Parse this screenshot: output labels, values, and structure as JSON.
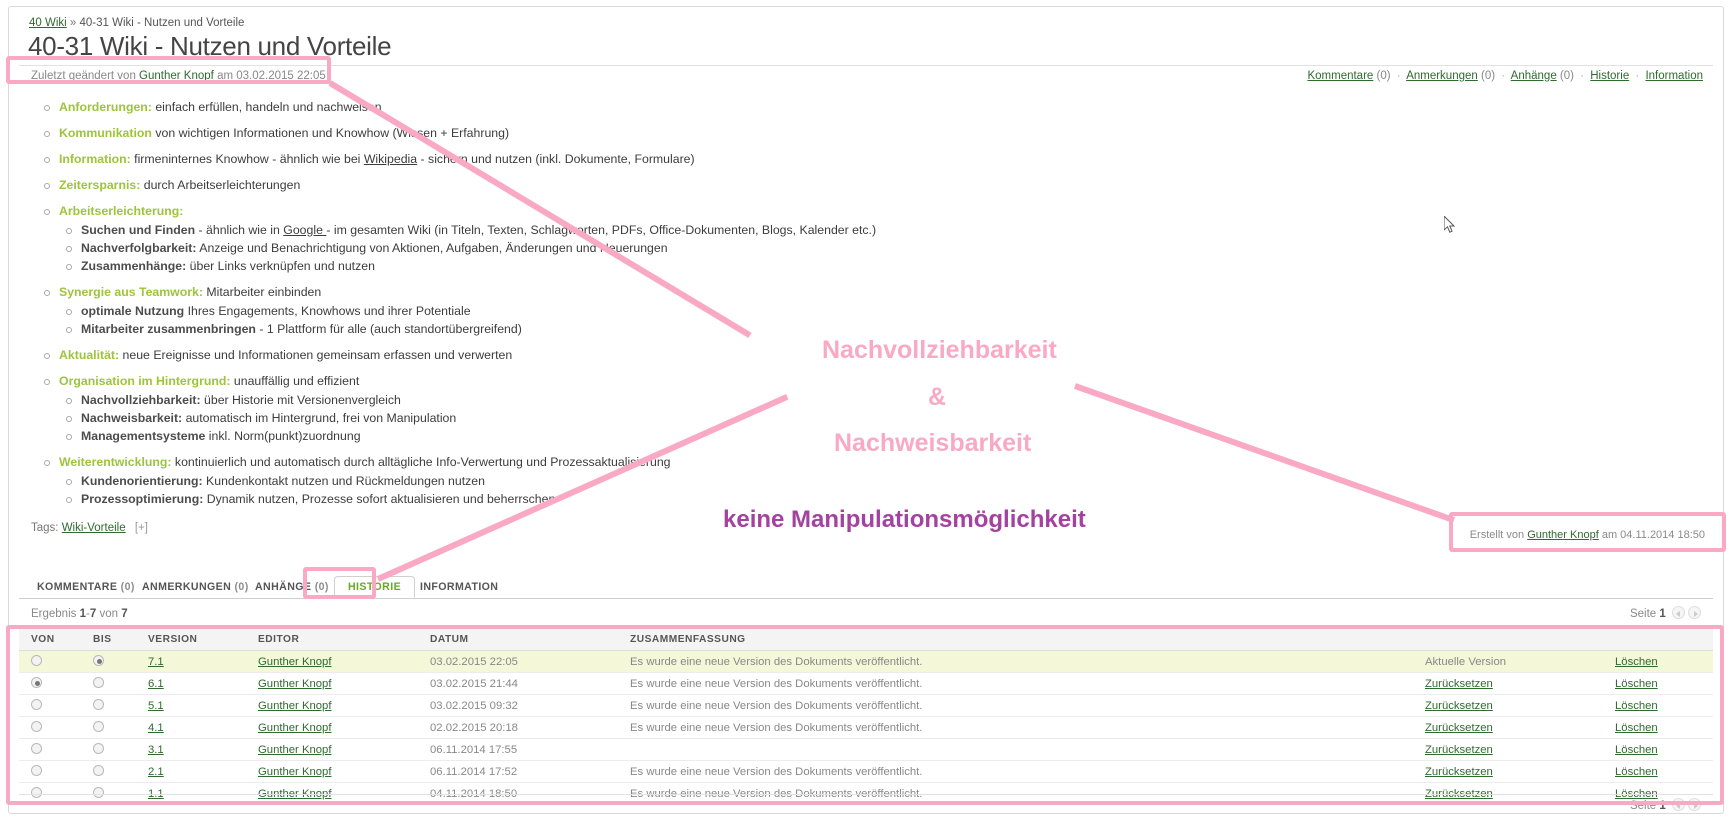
{
  "breadcrumb": {
    "root": "40 Wiki",
    "separator": "»",
    "current": "40-31 Wiki - Nutzen und Vorteile"
  },
  "page_title": "40-31 Wiki - Nutzen und Vorteile",
  "meta": {
    "modified_prefix": "Zuletzt geändert von",
    "modified_author": "Gunther Knopf",
    "modified_middle": "am",
    "modified_date": "03.02.2015 22:05"
  },
  "action_links": [
    {
      "label": "Kommentare",
      "count": "(0)"
    },
    {
      "label": "Anmerkungen",
      "count": "(0)"
    },
    {
      "label": "Anhänge",
      "count": "(0)"
    },
    {
      "label": "Historie",
      "count": ""
    },
    {
      "label": "Information",
      "count": ""
    }
  ],
  "content": {
    "items": [
      {
        "key": "Anforderungen:",
        "rest": " einfach erfüllen, handeln und nachweisen",
        "sub": []
      },
      {
        "key": "Kommunikation",
        "rest": " von wichtigen Informationen und Knowhow (Wissen + Erfahrung)",
        "sub": []
      },
      {
        "key": "Information:",
        "rest": " firmeninternes Knowhow - ähnlich wie bei ",
        "link": "Wikipedia",
        "rest2": " - sichern und nutzen (inkl. Dokumente, Formulare)",
        "sub": []
      },
      {
        "key": "Zeitersparnis:",
        "rest": " durch Arbeitserleichterungen",
        "sub": []
      },
      {
        "key": "Arbeitserleichterung:",
        "rest": "",
        "sub": [
          {
            "key": "Suchen und Finden",
            "rest": " - ähnlich wie in ",
            "link": "Google ",
            "rest2": "- im gesamten Wiki (in Titeln, Texten, Schlagworten, PDFs, Office-Dokumenten, Blogs, Kalender etc.)"
          },
          {
            "key": "Nachverfolgbarkeit:",
            "rest": " Anzeige und Benachrichtigung von Aktionen, Aufgaben, Änderungen und Neuerungen"
          },
          {
            "key": "Zusammenhänge:",
            "rest": " über Links verknüpfen und nutzen"
          }
        ]
      },
      {
        "key": "Synergie aus Teamwork:",
        "rest": " Mitarbeiter einbinden",
        "sub": [
          {
            "key": "optimale Nutzung",
            "rest": " Ihres Engagements, Knowhows und ihrer Potentiale"
          },
          {
            "key": "Mitarbeiter zusammenbringen",
            "rest": " - 1 Plattform für alle (auch standortübergreifend)"
          }
        ]
      },
      {
        "key": "Aktualität:",
        "rest": " neue Ereignisse und Informationen gemeinsam erfassen und verwerten",
        "sub": []
      },
      {
        "key": "Organisation im Hintergrund:",
        "rest": " unauffällig und effizient",
        "sub": [
          {
            "key": "Nachvollziehbarkeit:",
            "rest": " über Historie mit Versionenvergleich"
          },
          {
            "key": "Nachweisbarkeit:",
            "rest": " automatisch im Hintergrund, frei von Manipulation"
          },
          {
            "key": "Managementsysteme",
            "rest": " inkl. Norm(punkt)zuordnung"
          }
        ]
      },
      {
        "key": "Weiterentwicklung:",
        "rest": "  kontinuierlich und automatisch durch alltägliche Info-Verwertung und Prozessaktualisierung",
        "sub": [
          {
            "key": "Kundenorientierung:",
            "rest": " Kundenkontakt nutzen und Rückmeldungen nutzen"
          },
          {
            "key": "Prozessoptimierung:",
            "rest": " Dynamik nutzen, Prozesse sofort aktualisieren und beherrschen"
          }
        ]
      }
    ]
  },
  "tags": {
    "label": "Tags:",
    "value": "Wiki-Vorteile",
    "expand": "[+]"
  },
  "tabs": [
    {
      "label": "KOMMENTARE",
      "count": "(0)",
      "active": false
    },
    {
      "label": "ANMERKUNGEN",
      "count": "(0)",
      "active": false
    },
    {
      "label": "ANHÄNGE",
      "count": "(0)",
      "active": false
    },
    {
      "label": "HISTORIE",
      "count": "",
      "active": true
    },
    {
      "label": "INFORMATION",
      "count": "",
      "active": false
    }
  ],
  "result": {
    "prefix": "Ergebnis",
    "from": "1",
    "dash": "-",
    "to": "7",
    "von": "von",
    "total": "7",
    "page_label": "Seite",
    "page_number": "1"
  },
  "table": {
    "headers": [
      "VON",
      "BIS",
      "VERSION",
      "EDITOR",
      "DATUM",
      "ZUSAMMENFASSUNG",
      "",
      ""
    ],
    "rows": [
      {
        "von": false,
        "bis": true,
        "version": "7.1",
        "editor": "Gunther Knopf",
        "datum": "03.02.2015 22:05",
        "summary": "Es wurde eine neue Version des Dokuments veröffentlicht.",
        "action": "Aktuelle Version",
        "action_link": false,
        "delete": "Löschen",
        "current": true
      },
      {
        "von": true,
        "bis": false,
        "version": "6.1",
        "editor": "Gunther Knopf",
        "datum": "03.02.2015 21:44",
        "summary": "Es wurde eine neue Version des Dokuments veröffentlicht.",
        "action": "Zurücksetzen",
        "action_link": true,
        "delete": "Löschen",
        "current": false
      },
      {
        "von": false,
        "bis": false,
        "version": "5.1",
        "editor": "Gunther Knopf",
        "datum": "03.02.2015 09:32",
        "summary": "Es wurde eine neue Version des Dokuments veröffentlicht.",
        "action": "Zurücksetzen",
        "action_link": true,
        "delete": "Löschen",
        "current": false
      },
      {
        "von": false,
        "bis": false,
        "version": "4.1",
        "editor": "Gunther Knopf",
        "datum": "02.02.2015 20:18",
        "summary": "Es wurde eine neue Version des Dokuments veröffentlicht.",
        "action": "Zurücksetzen",
        "action_link": true,
        "delete": "Löschen",
        "current": false
      },
      {
        "von": false,
        "bis": false,
        "version": "3.1",
        "editor": "Gunther Knopf",
        "datum": "06.11.2014 17:55",
        "summary": "",
        "action": "Zurücksetzen",
        "action_link": true,
        "delete": "Löschen",
        "current": false
      },
      {
        "von": false,
        "bis": false,
        "version": "2.1",
        "editor": "Gunther Knopf",
        "datum": "06.11.2014 17:52",
        "summary": "Es wurde eine neue Version des Dokuments veröffentlicht.",
        "action": "Zurücksetzen",
        "action_link": true,
        "delete": "Löschen",
        "current": false
      },
      {
        "von": false,
        "bis": false,
        "version": "1.1",
        "editor": "Gunther Knopf",
        "datum": "04.11.2014 18:50",
        "summary": "Es wurde eine neue Version des Dokuments veröffentlicht.",
        "action": "Zurücksetzen",
        "action_link": true,
        "delete": "Löschen",
        "current": false
      }
    ]
  },
  "created": {
    "prefix": "Erstellt von",
    "author": "Gunther Knopf",
    "middle": "am",
    "date": "04.11.2014 18:50"
  },
  "annotations": {
    "line1": "Nachvollziehbarkeit",
    "amp": "&",
    "line2": "Nachweisbarkeit",
    "line3": "keine Manipulationsmöglichkeit",
    "pink_color": "#f9a9c4",
    "purple_color": "#a4429f"
  }
}
